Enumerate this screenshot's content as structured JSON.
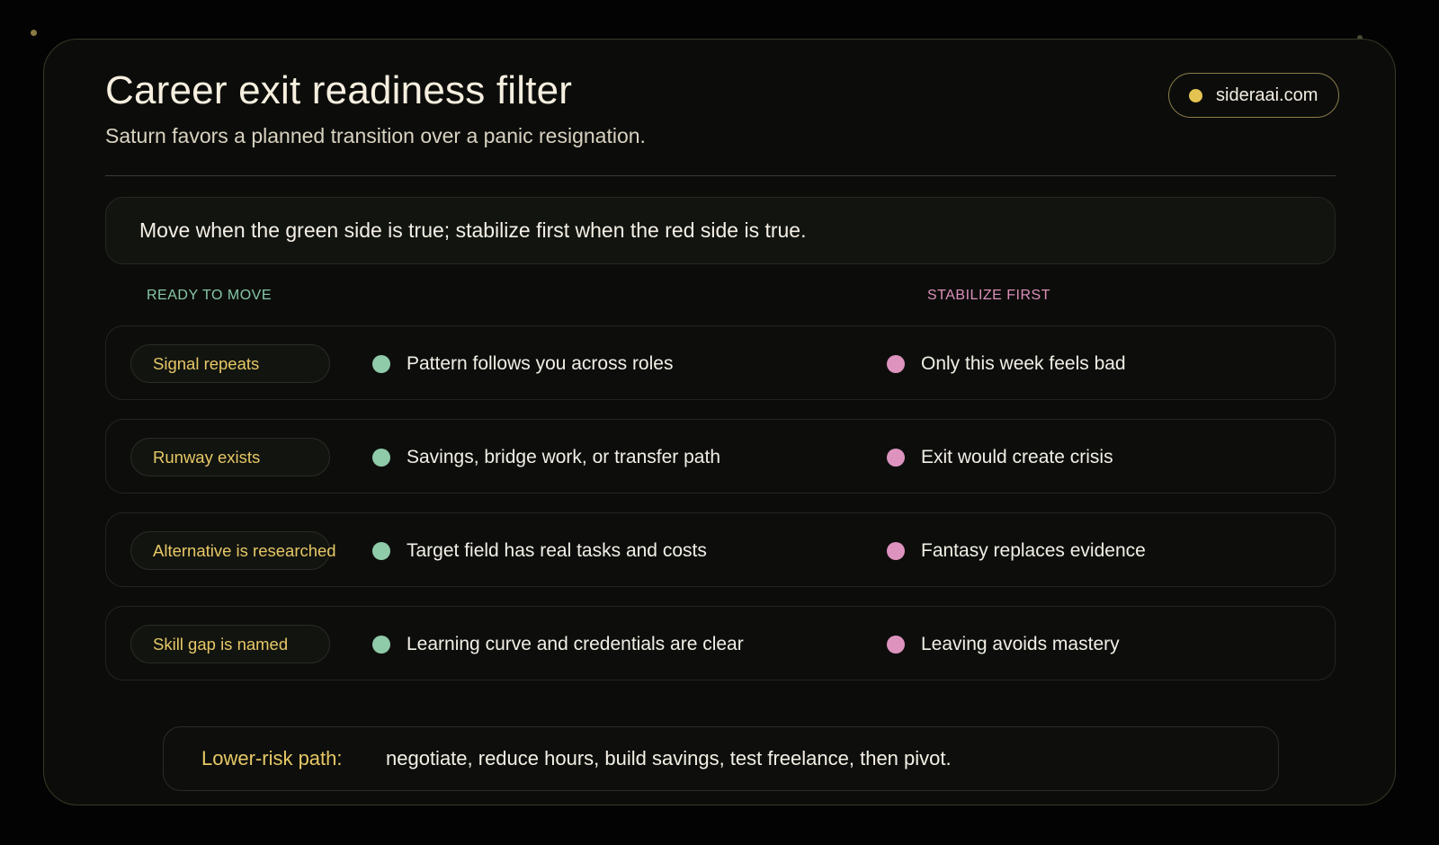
{
  "header": {
    "title": "Career exit readiness filter",
    "subtitle": "Saturn favors a planned transition over a panic resignation.",
    "brand": "sideraai.com"
  },
  "callout": {
    "text": "Move when the green side is true; stabilize first when the red side is true."
  },
  "columns": {
    "ready": "READY TO MOVE",
    "stabilize": "STABILIZE FIRST"
  },
  "rows": [
    {
      "signal": "Signal repeats",
      "ready": "Pattern follows you across roles",
      "stabilize": "Only this week feels bad"
    },
    {
      "signal": "Runway exists",
      "ready": "Savings, bridge work, or transfer path",
      "stabilize": "Exit would create crisis"
    },
    {
      "signal": "Alternative is researched",
      "ready": "Target field has real tasks and costs",
      "stabilize": "Fantasy replaces evidence"
    },
    {
      "signal": "Skill gap is named",
      "ready": "Learning curve and credentials are clear",
      "stabilize": "Leaving avoids mastery"
    }
  ],
  "footer": {
    "label": "Lower-risk path:",
    "text": "negotiate, reduce hours, build savings, test freelance, then pivot."
  },
  "colors": {
    "accent_gold": "#e6c866",
    "ready_green": "#8fcaa9",
    "stabilize_pink": "#de93bf",
    "background": "#0c0d0b"
  },
  "icons": {
    "brand": "gold-dot-icon",
    "ready": "green-bullet-icon",
    "stabilize": "pink-bullet-icon"
  }
}
